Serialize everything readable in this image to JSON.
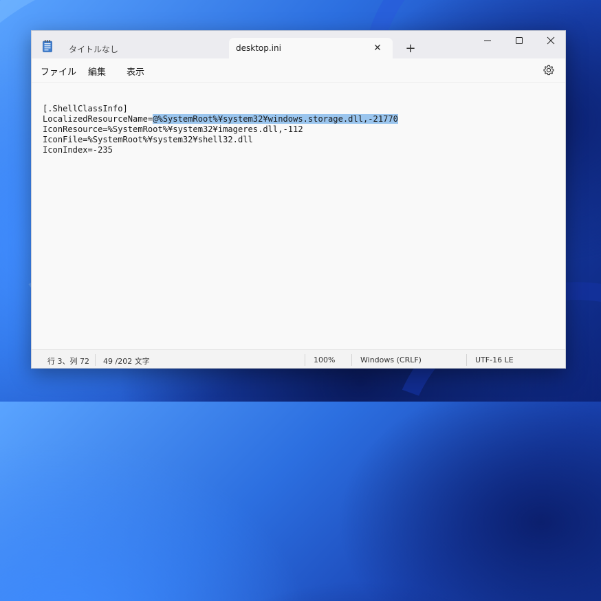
{
  "window": {
    "tabs": [
      {
        "label": "タイトルなし",
        "active": false
      },
      {
        "label": "desktop.ini",
        "active": true
      }
    ],
    "new_tab_symbol": "+",
    "close_tab_symbol": "✕"
  },
  "menu": {
    "items": [
      "ファイル",
      "編集",
      "表示"
    ]
  },
  "editor": {
    "lines": [
      {
        "text": "[.ShellClassInfo]",
        "pre": "",
        "selected": ""
      },
      {
        "text": "",
        "pre": "LocalizedResourceName=",
        "selected": "@%SystemRoot%¥system32¥windows.storage.dll,-21770"
      },
      {
        "text": "IconResource=%SystemRoot%¥system32¥imageres.dll,-112",
        "pre": "",
        "selected": ""
      },
      {
        "text": "IconFile=%SystemRoot%¥system32¥shell32.dll",
        "pre": "",
        "selected": ""
      },
      {
        "text": "IconIndex=-235",
        "pre": "",
        "selected": ""
      }
    ],
    "selection_color": "#9ac5ee"
  },
  "status": {
    "position": "行 3、列 72",
    "count": "49 /202 文字",
    "zoom": "100%",
    "line_ending": "Windows (CRLF)",
    "encoding": "UTF-16 LE"
  },
  "icons": [
    "notepad-app-icon",
    "close-icon",
    "plus-icon",
    "minimize-icon",
    "maximize-icon",
    "window-close-icon",
    "gear-icon"
  ]
}
